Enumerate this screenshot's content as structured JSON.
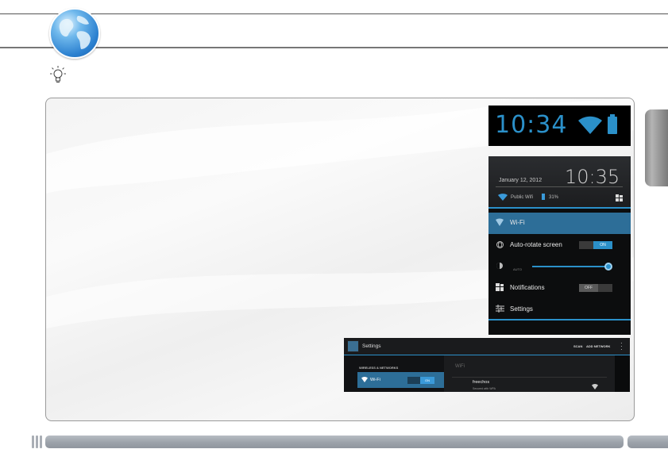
{
  "statusbar": {
    "time": "10:34"
  },
  "notification_panel": {
    "date": "January 12, 2012",
    "time": "10:35",
    "network_name": "Public Wifi",
    "battery_percent": "31%",
    "items": [
      {
        "label": "Wi-Fi",
        "icon": "wifi-icon"
      },
      {
        "label": "Auto-rotate screen",
        "icon": "rotate-icon",
        "toggle": "ON"
      },
      {
        "label": "",
        "icon": "brightness-icon",
        "sub_label": "AUTO",
        "level": 1.0
      },
      {
        "label": "Notifications",
        "icon": "notifications-icon",
        "toggle": "OFF"
      },
      {
        "label": "Settings",
        "icon": "settings-sliders-icon"
      }
    ]
  },
  "settings_screen": {
    "title": "Settings",
    "actions": [
      "SCAN",
      "ADD NETWORK"
    ],
    "section": "WIRELESS & NETWORKS",
    "wifi_label": "Wi-Fi",
    "wifi_toggle": "ON",
    "right_header": "WiFi",
    "network": {
      "ssid": "freechos",
      "security": "Secured with WPA"
    }
  },
  "colors": {
    "accent": "#2b90c9",
    "selected_row": "#2d6e98",
    "panel_bg": "#0c0d0e"
  },
  "icons": {
    "header": "globe-icon",
    "tip": "lightbulb-icon"
  }
}
